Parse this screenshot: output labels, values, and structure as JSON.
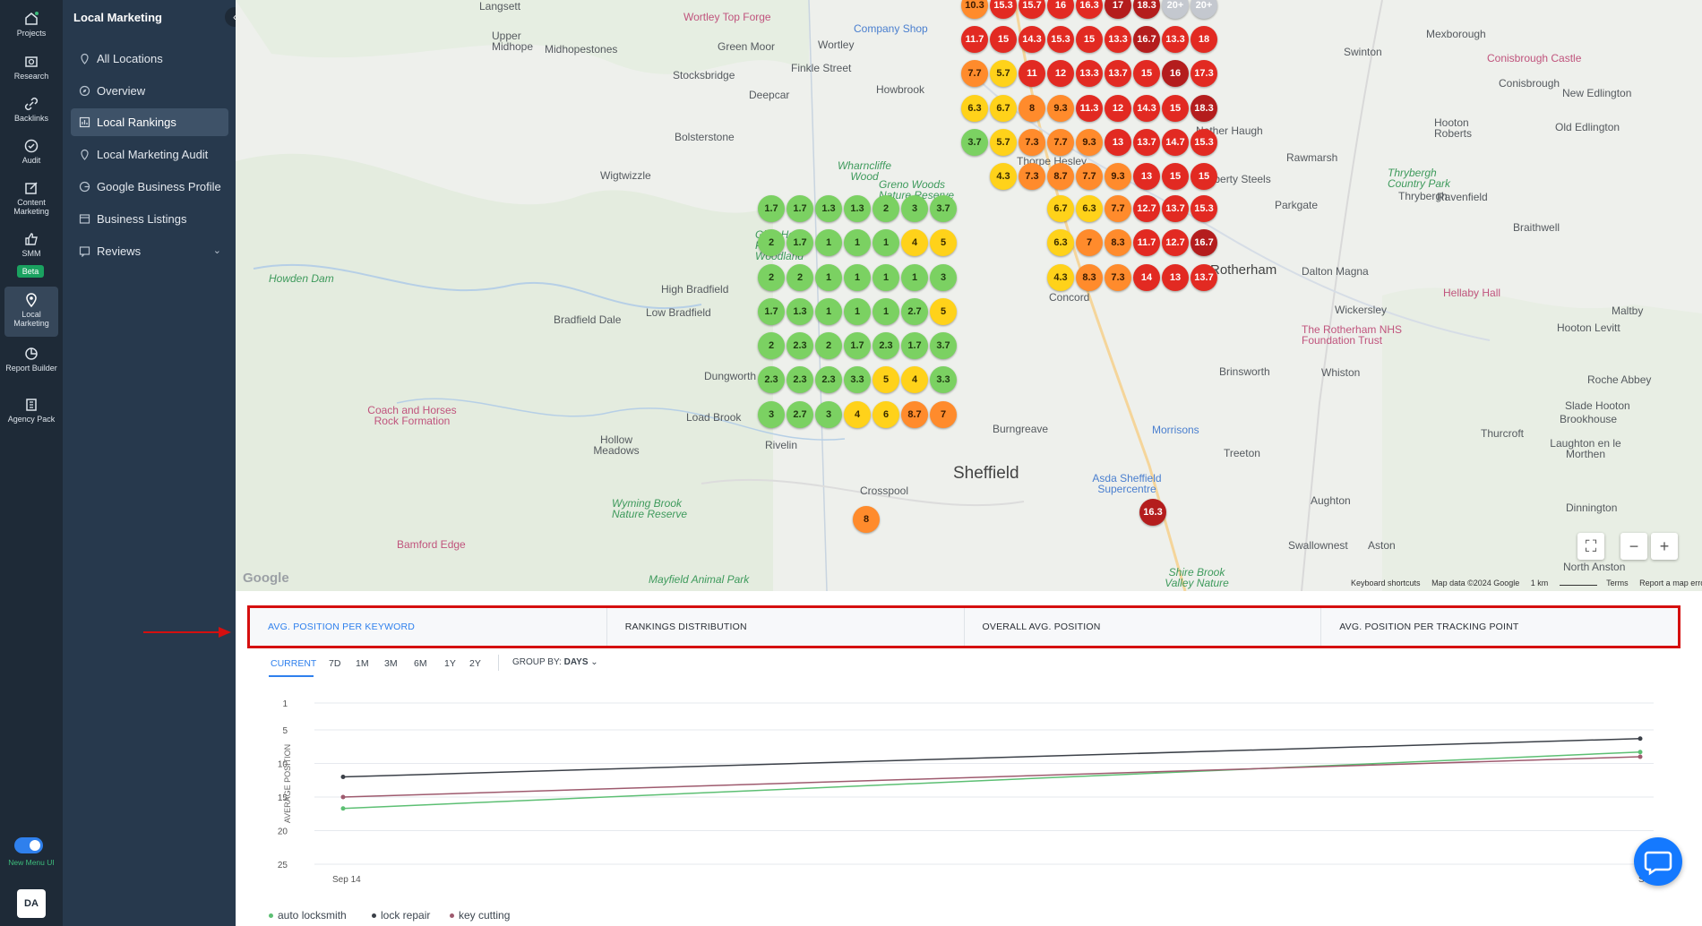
{
  "rail": {
    "items": [
      {
        "label": "Projects",
        "icon": "home-icon"
      },
      {
        "label": "Research",
        "icon": "research-icon"
      },
      {
        "label": "Backlinks",
        "icon": "link-icon"
      },
      {
        "label": "Audit",
        "icon": "audit-icon"
      },
      {
        "label": "Content Marketing",
        "icon": "edit-icon"
      },
      {
        "label": "SMM",
        "icon": "thumbs-up-icon"
      },
      {
        "label": "Local Marketing",
        "icon": "location-pin-icon"
      },
      {
        "label": "Report Builder",
        "icon": "report-icon"
      },
      {
        "label": "Agency Pack",
        "icon": "building-icon"
      }
    ],
    "beta_badge": "Beta",
    "new_menu_label": "New Menu UI",
    "avatar_initials": "DA"
  },
  "subnav": {
    "title": "Local Marketing",
    "items": [
      {
        "label": "All Locations",
        "icon": "location-pin-icon"
      },
      {
        "label": "Overview",
        "icon": "compass-icon"
      },
      {
        "label": "Local Rankings",
        "icon": "bar-chart-icon",
        "active": true
      },
      {
        "label": "Local Marketing Audit",
        "icon": "location-check-icon"
      },
      {
        "label": "Google Business Profile",
        "icon": "google-icon"
      },
      {
        "label": "Business Listings",
        "icon": "listings-icon"
      },
      {
        "label": "Reviews",
        "icon": "reviews-icon",
        "has_dropdown": true
      }
    ]
  },
  "map": {
    "labels": [
      "Langsett",
      "Upper Midhope",
      "Midhopestones",
      "Green Moor",
      "Wortley",
      "Stocksbridge",
      "Finkle Street",
      "Howbrook",
      "Deepcar",
      "Bolsterstone",
      "Wigtwizzle",
      "Wharncliffe Wood",
      "Greno Woods Nature Reserve",
      "Thorpe Hesley",
      "Glen Howe Pk Woodland",
      "Howden Dam",
      "High Bradfield",
      "Low Bradfield",
      "Bradfield Dale",
      "Dungworth",
      "Load Brook",
      "Coach and Horses Rock Formation",
      "Hollow Meadows",
      "Wyming Brook Nature Reserve",
      "Bamford Edge",
      "Mayfield Animal Park",
      "Crosspool",
      "Sheffield",
      "Rotherham",
      "Dalton Magna",
      "Wickersley",
      "Brinsworth",
      "Treeton",
      "Whiston",
      "Aughton",
      "Swallownest",
      "Aston",
      "North Anston",
      "Dinnington",
      "Rawmarsh",
      "Parkgate",
      "Thrybergh",
      "Ravenfield",
      "Braithwell",
      "Maltby",
      "Hooton Levitt",
      "Roche Abbey",
      "Slade Hooton",
      "Brookhouse",
      "Thurcroft",
      "Laughton en le Morthen",
      "Swinton",
      "Mexborough",
      "Conisbrough",
      "Conisbrough Castle",
      "New Edlington",
      "Old Edlington",
      "Hooton Roberts",
      "Thrybergh Country Park",
      "Hellaby Hall",
      "The Rotherham NHS Foundation Trust",
      "Morrisons",
      "Asda Sheffield Supercentre",
      "Shire Brook Valley Nature",
      "Company Shop",
      "Wortley Top Forge",
      "Liberty Steels",
      "Nether Haugh",
      "Concord",
      "Burngreave",
      "Rivelin"
    ],
    "pins": [
      {
        "v": "10.3",
        "c": "orange"
      },
      {
        "v": "15.3",
        "c": "red"
      },
      {
        "v": "15.7",
        "c": "red"
      },
      {
        "v": "16",
        "c": "red"
      },
      {
        "v": "16.3",
        "c": "red"
      },
      {
        "v": "17",
        "c": "darkred"
      },
      {
        "v": "18.3",
        "c": "darkred"
      },
      {
        "v": "20+",
        "c": "grey"
      },
      {
        "v": "20+",
        "c": "grey"
      },
      {
        "v": "11.7",
        "c": "red"
      },
      {
        "v": "15",
        "c": "red"
      },
      {
        "v": "14.3",
        "c": "red"
      },
      {
        "v": "15.3",
        "c": "red"
      },
      {
        "v": "15",
        "c": "red"
      },
      {
        "v": "13.3",
        "c": "red"
      },
      {
        "v": "16.7",
        "c": "darkred"
      },
      {
        "v": "13.3",
        "c": "red"
      },
      {
        "v": "18",
        "c": "red"
      },
      {
        "v": "7.7",
        "c": "orange"
      },
      {
        "v": "5.7",
        "c": "yellow"
      },
      {
        "v": "11",
        "c": "red"
      },
      {
        "v": "12",
        "c": "red"
      },
      {
        "v": "13.3",
        "c": "red"
      },
      {
        "v": "13.7",
        "c": "red"
      },
      {
        "v": "15",
        "c": "red"
      },
      {
        "v": "16",
        "c": "darkred"
      },
      {
        "v": "17.3",
        "c": "red"
      },
      {
        "v": "6.3",
        "c": "yellow"
      },
      {
        "v": "6.7",
        "c": "yellow"
      },
      {
        "v": "8",
        "c": "orange"
      },
      {
        "v": "9.3",
        "c": "orange"
      },
      {
        "v": "11.3",
        "c": "red"
      },
      {
        "v": "12",
        "c": "red"
      },
      {
        "v": "14.3",
        "c": "red"
      },
      {
        "v": "15",
        "c": "red"
      },
      {
        "v": "18.3",
        "c": "darkred"
      },
      {
        "v": "3.7",
        "c": "green"
      },
      {
        "v": "5.7",
        "c": "yellow"
      },
      {
        "v": "7.3",
        "c": "orange"
      },
      {
        "v": "7.7",
        "c": "orange"
      },
      {
        "v": "9.3",
        "c": "orange"
      },
      {
        "v": "13",
        "c": "red"
      },
      {
        "v": "13.7",
        "c": "red"
      },
      {
        "v": "14.7",
        "c": "red"
      },
      {
        "v": "15.3",
        "c": "red"
      },
      {
        "v": "4.3",
        "c": "yellow"
      },
      {
        "v": "7.3",
        "c": "orange"
      },
      {
        "v": "8.7",
        "c": "orange"
      },
      {
        "v": "7.7",
        "c": "orange"
      },
      {
        "v": "9.3",
        "c": "orange"
      },
      {
        "v": "13",
        "c": "red"
      },
      {
        "v": "15",
        "c": "red"
      },
      {
        "v": "15",
        "c": "red"
      },
      {
        "v": "1.7",
        "c": "green"
      },
      {
        "v": "1.7",
        "c": "green"
      },
      {
        "v": "1.3",
        "c": "green"
      },
      {
        "v": "1.3",
        "c": "green"
      },
      {
        "v": "2",
        "c": "green"
      },
      {
        "v": "3",
        "c": "green"
      },
      {
        "v": "3.7",
        "c": "green"
      },
      {
        "v": "6.7",
        "c": "yellow"
      },
      {
        "v": "6.3",
        "c": "yellow"
      },
      {
        "v": "7.7",
        "c": "orange"
      },
      {
        "v": "12.7",
        "c": "red"
      },
      {
        "v": "13.7",
        "c": "red"
      },
      {
        "v": "15.3",
        "c": "red"
      },
      {
        "v": "2",
        "c": "green"
      },
      {
        "v": "1.7",
        "c": "green"
      },
      {
        "v": "1",
        "c": "green"
      },
      {
        "v": "1",
        "c": "green"
      },
      {
        "v": "1",
        "c": "green"
      },
      {
        "v": "4",
        "c": "yellow"
      },
      {
        "v": "5",
        "c": "yellow"
      },
      {
        "v": "6.3",
        "c": "yellow"
      },
      {
        "v": "7",
        "c": "orange"
      },
      {
        "v": "8.3",
        "c": "orange"
      },
      {
        "v": "11.7",
        "c": "red"
      },
      {
        "v": "12.7",
        "c": "red"
      },
      {
        "v": "16.7",
        "c": "darkred"
      },
      {
        "v": "2",
        "c": "green"
      },
      {
        "v": "2",
        "c": "green"
      },
      {
        "v": "1",
        "c": "green"
      },
      {
        "v": "1",
        "c": "green"
      },
      {
        "v": "1",
        "c": "green"
      },
      {
        "v": "1",
        "c": "green"
      },
      {
        "v": "3",
        "c": "green"
      },
      {
        "v": "4.3",
        "c": "yellow"
      },
      {
        "v": "8.3",
        "c": "orange"
      },
      {
        "v": "7.3",
        "c": "orange"
      },
      {
        "v": "14",
        "c": "red"
      },
      {
        "v": "13",
        "c": "red"
      },
      {
        "v": "13.7",
        "c": "red"
      },
      {
        "v": "1.7",
        "c": "green"
      },
      {
        "v": "1.3",
        "c": "green"
      },
      {
        "v": "1",
        "c": "green"
      },
      {
        "v": "1",
        "c": "green"
      },
      {
        "v": "1",
        "c": "green"
      },
      {
        "v": "2.7",
        "c": "green"
      },
      {
        "v": "5",
        "c": "yellow"
      },
      {
        "v": "2",
        "c": "green"
      },
      {
        "v": "2.3",
        "c": "green"
      },
      {
        "v": "2",
        "c": "green"
      },
      {
        "v": "1.7",
        "c": "green"
      },
      {
        "v": "2.3",
        "c": "green"
      },
      {
        "v": "1.7",
        "c": "green"
      },
      {
        "v": "3.7",
        "c": "green"
      },
      {
        "v": "2.3",
        "c": "green"
      },
      {
        "v": "2.3",
        "c": "green"
      },
      {
        "v": "2.3",
        "c": "green"
      },
      {
        "v": "3.3",
        "c": "green"
      },
      {
        "v": "5",
        "c": "yellow"
      },
      {
        "v": "4",
        "c": "yellow"
      },
      {
        "v": "3.3",
        "c": "green"
      },
      {
        "v": "3",
        "c": "green"
      },
      {
        "v": "2.7",
        "c": "green"
      },
      {
        "v": "3",
        "c": "green"
      },
      {
        "v": "4",
        "c": "yellow"
      },
      {
        "v": "6",
        "c": "yellow"
      },
      {
        "v": "8.7",
        "c": "orange"
      },
      {
        "v": "7",
        "c": "orange"
      },
      {
        "v": "8",
        "c": "orange"
      },
      {
        "v": "16.3",
        "c": "darkred"
      }
    ],
    "footer": {
      "shortcuts": "Keyboard shortcuts",
      "data": "Map data ©2024 Google",
      "scale": "1 km",
      "terms": "Terms",
      "report": "Report a map error"
    },
    "google": "Google"
  },
  "tabs": [
    {
      "label": "AVG. POSITION PER KEYWORD",
      "active": true
    },
    {
      "label": "RANKINGS DISTRIBUTION"
    },
    {
      "label": "OVERALL AVG. POSITION"
    },
    {
      "label": "AVG. POSITION PER TRACKING POINT"
    }
  ],
  "periods": [
    "CURRENT",
    "7D",
    "1M",
    "3M",
    "6M",
    "1Y",
    "2Y"
  ],
  "group_by": {
    "label": "GROUP BY:",
    "value": "DAYS"
  },
  "chart_data": {
    "type": "line",
    "ylabel": "AVERAGE POSITION",
    "yticks": [
      1,
      5,
      10,
      15,
      20,
      25
    ],
    "ylim": [
      1,
      25
    ],
    "y_inverted": true,
    "x": [
      "Sep 14",
      "S"
    ],
    "series": [
      {
        "name": "auto locksmith",
        "color": "#5cbf73",
        "values": [
          16.7,
          8.3
        ]
      },
      {
        "name": "lock repair",
        "color": "#3b4048",
        "values": [
          12,
          6.3
        ]
      },
      {
        "name": "key cutting",
        "color": "#9e5a6e",
        "values": [
          15,
          9
        ]
      }
    ],
    "grid": true,
    "legend": "bottom-left"
  }
}
